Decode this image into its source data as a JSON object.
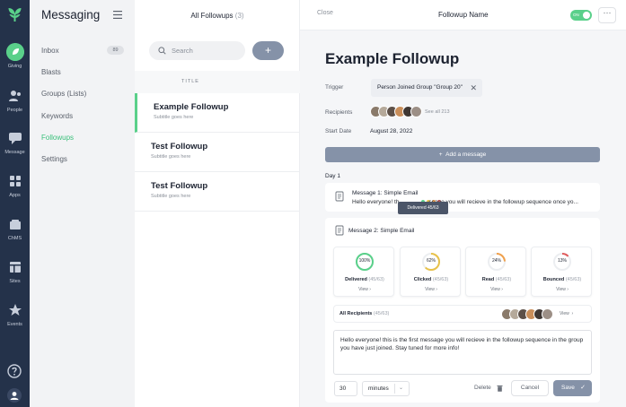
{
  "rail": {
    "items": [
      {
        "label": "Giving",
        "icon": "leaf-icon"
      },
      {
        "label": "People",
        "icon": "people-icon"
      },
      {
        "label": "Message",
        "icon": "chat-icon"
      },
      {
        "label": "Apps",
        "icon": "apps-grid-icon"
      },
      {
        "label": "ChMS",
        "icon": "church-icon"
      },
      {
        "label": "Sites",
        "icon": "sites-icon"
      },
      {
        "label": "Events",
        "icon": "star-icon"
      }
    ],
    "accent": "#5ad08a",
    "background": "#24324a"
  },
  "sidebar": {
    "title": "Messaging",
    "items": [
      {
        "label": "Inbox",
        "badge": "89"
      },
      {
        "label": "Blasts"
      },
      {
        "label": "Groups (Lists)"
      },
      {
        "label": "Keywords"
      },
      {
        "label": "Followups"
      },
      {
        "label": "Settings"
      }
    ],
    "active_item": "Followups"
  },
  "list": {
    "title": "All Followups",
    "count": "(3)",
    "search_placeholder": "Search",
    "add_label": "+",
    "column_header": "TITLE",
    "rows": [
      {
        "title": "Example Followup",
        "subtitle": "Subtitle goes here"
      },
      {
        "title": "Test Followup",
        "subtitle": "Subtitle goes here"
      },
      {
        "title": "Test Followup",
        "subtitle": "Subtitle goes here"
      }
    ]
  },
  "detail": {
    "close_label": "Close",
    "name_label": "Followup Name",
    "toggle_label": "ON",
    "more_label": "···",
    "heading": "Example Followup",
    "trigger_label": "Trigger",
    "trigger_value": "Person Joined Group  \"Group 20\"",
    "recipients_label": "Recipients",
    "see_all": "See all 213",
    "start_date_label": "Start Date",
    "start_date": "August 28, 2022",
    "add_message_label": "Add a message",
    "day_label": "Day 1",
    "message1": {
      "title": "Message 1: Simple Email",
      "body": "Hello everyone! th",
      "body_tail": "ssage you will recieve in the followup sequence once yo...",
      "tooltip": "Delivered 45/63"
    },
    "message2": {
      "title": "Message 2: Simple Email",
      "stats": [
        {
          "label": "Delivered",
          "fraction": "(45/63)",
          "percent_text": "100%",
          "percent": 100,
          "color": "#5ad08a",
          "view": "View"
        },
        {
          "label": "Clicked",
          "fraction": "(45/63)",
          "percent_text": "62%",
          "percent": 62,
          "color": "#e8c24a",
          "view": "View"
        },
        {
          "label": "Read",
          "fraction": "(45/63)",
          "percent_text": "24%",
          "percent": 24,
          "color": "#f0a04b",
          "view": "View"
        },
        {
          "label": "Bounced",
          "fraction": "(45/63)",
          "percent_text": "13%",
          "percent": 13,
          "color": "#e05a5a",
          "view": "View"
        }
      ],
      "all_recipients_label": "All Recipients",
      "all_recipients_fraction": "(45/63)",
      "all_recipients_view": "View",
      "body": "Hello everyone! this is the first message you will recieve in the followup sequence in the group you have just joined. Stay tuned for more info!",
      "delay_value": "30",
      "delay_unit": "minutes",
      "delete_label": "Delete",
      "cancel_label": "Cancel",
      "save_label": "Save"
    }
  }
}
